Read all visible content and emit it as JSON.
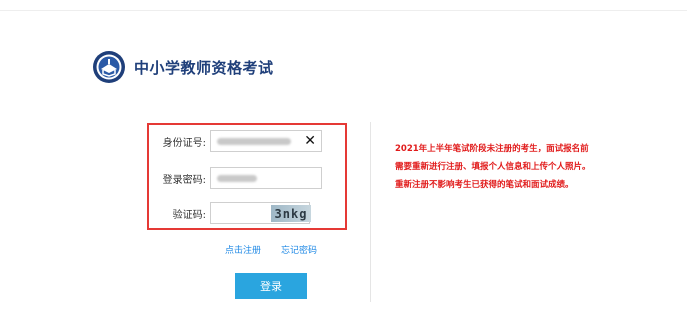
{
  "brand": {
    "title": "中小学教师资格考试",
    "logo_icon": "ntce-emblem-icon",
    "color": "#1f3f7a"
  },
  "form": {
    "id_label": "身份证号:",
    "password_label": "登录密码:",
    "captcha_label": "验证码:",
    "captcha_text": "3nkg",
    "clear_icon": "close-icon",
    "clear_glyph": "✕"
  },
  "links": {
    "register": "点击注册",
    "forgot": "忘记密码"
  },
  "login_button": "登录",
  "notice": "2021年上半年笔试阶段未注册的考生，面试报名前需要重新进行注册、填报个人信息和上传个人照片。重新注册不影响考生已获得的笔试和面试成绩。",
  "colors": {
    "highlight_border": "#e53935",
    "button_bg": "#2aa5df",
    "link": "#1e88e5",
    "notice_text": "#e11b1b"
  }
}
